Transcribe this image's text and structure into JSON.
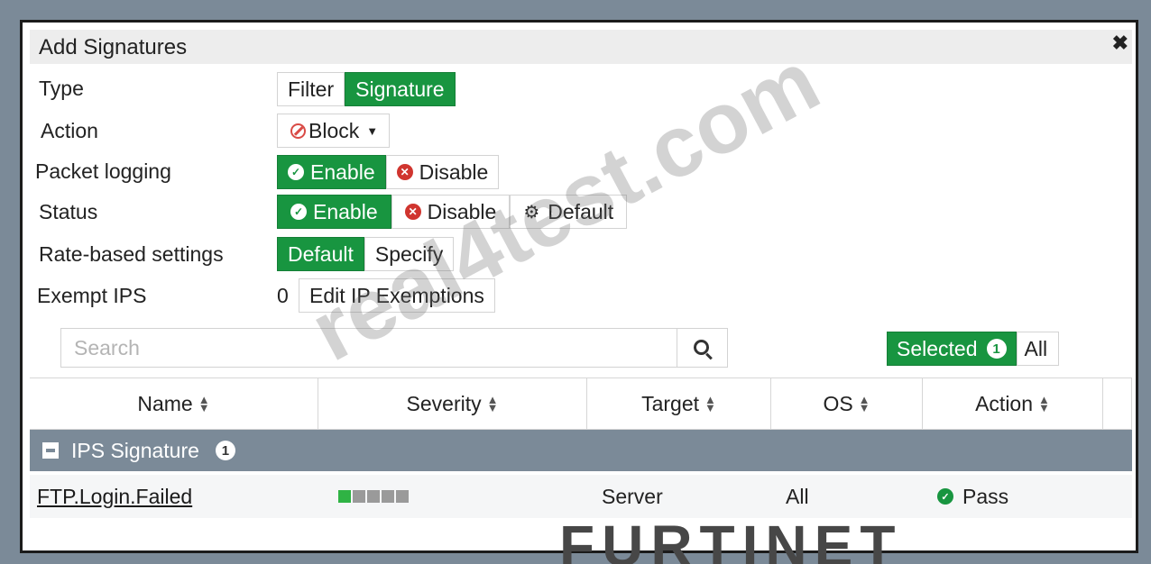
{
  "dialog": {
    "title": "Add Signatures",
    "close_icon": "close-icon"
  },
  "form": {
    "type": {
      "label": "Type",
      "options": [
        "Filter",
        "Signature"
      ],
      "selected": "Signature"
    },
    "action": {
      "label": "Action",
      "value": "Block",
      "icon": "ban-icon"
    },
    "packet_logging": {
      "label": "Packet logging",
      "options": [
        "Enable",
        "Disable"
      ],
      "selected": "Enable"
    },
    "status": {
      "label": "Status",
      "options": [
        "Enable",
        "Disable",
        "Default"
      ],
      "selected": "Enable"
    },
    "rate_based": {
      "label": "Rate-based settings",
      "options": [
        "Default",
        "Specify"
      ],
      "selected": "Default"
    },
    "exempt_ips": {
      "label": "Exempt IPS",
      "count": "0",
      "button": "Edit IP Exemptions"
    }
  },
  "search": {
    "placeholder": "Search",
    "value": ""
  },
  "filter": {
    "selected_label": "Selected",
    "selected_count": "1",
    "all_label": "All",
    "active": "Selected"
  },
  "table": {
    "columns": [
      "Name",
      "Severity",
      "Target",
      "OS",
      "Action"
    ],
    "group": {
      "label": "IPS Signature",
      "count": "1"
    },
    "rows": [
      {
        "name": "FTP.Login.Failed",
        "severity_level": 1,
        "severity_max": 5,
        "target": "Server",
        "os": "All",
        "action": "Pass"
      }
    ]
  },
  "brand": {
    "logo_text": "FURTINET"
  },
  "overlay": {
    "watermark": "real4test.com"
  },
  "colors": {
    "accent_green": "#189540",
    "danger_red": "#d0352f",
    "frame_gray": "#7b8a98"
  }
}
